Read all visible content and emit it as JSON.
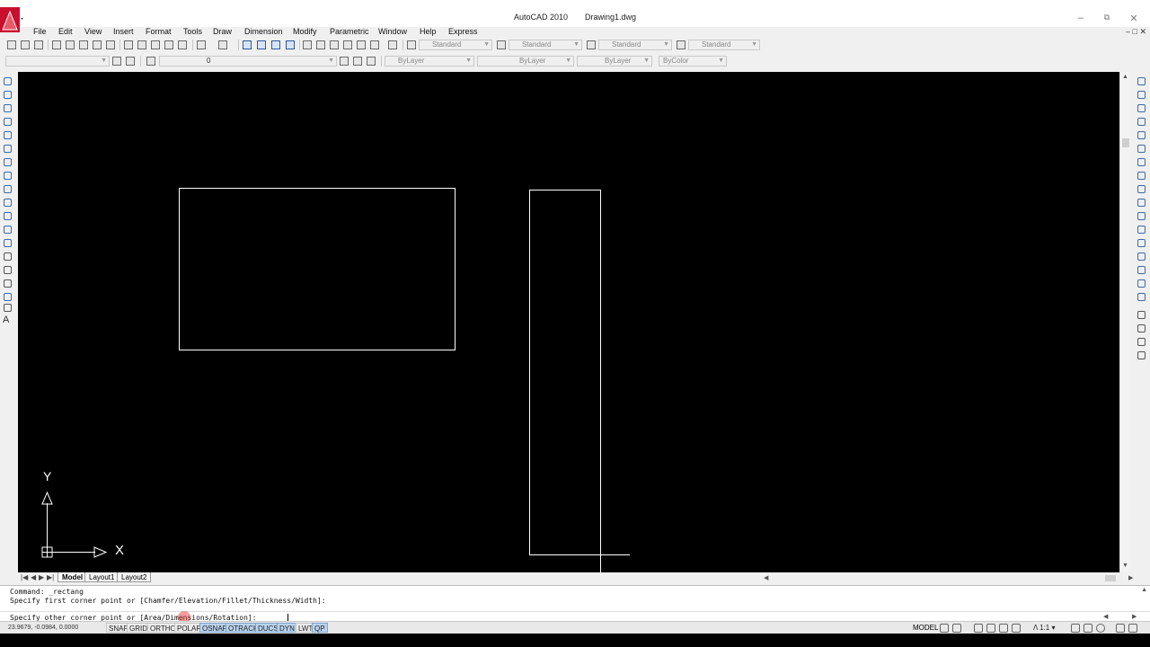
{
  "window": {
    "app_title": "AutoCAD 2010",
    "document_title": "Drawing1.dwg"
  },
  "menu": {
    "items": [
      "File",
      "Edit",
      "View",
      "Insert",
      "Format",
      "Tools",
      "Draw",
      "Dimension",
      "Modify",
      "Parametric",
      "Window",
      "Help",
      "Express"
    ]
  },
  "toolbar": {
    "text_style": "Standard",
    "dim_style": "Standard",
    "table_style": "Standard",
    "multileader_style": "Standard",
    "layer": "0",
    "color": "ByLayer",
    "linetype": "ByLayer",
    "lineweight": "ByLayer",
    "plot_style": "ByColor"
  },
  "canvas": {
    "background": "#000000",
    "line_color": "#ffffff",
    "ucs_x_label": "X",
    "ucs_y_label": "Y"
  },
  "tabs": {
    "items": [
      {
        "label": "Model",
        "active": true
      },
      {
        "label": "Layout1",
        "active": false
      },
      {
        "label": "Layout2",
        "active": false
      }
    ],
    "separator": "/"
  },
  "command": {
    "history": [
      "Command: _rectang",
      "Specify first corner point or [Chamfer/Elevation/Fillet/Thickness/Width]:"
    ],
    "prompt": "Specify other corner point or [Area/Dimensions/Rotation]: "
  },
  "status": {
    "coordinates": "23.9679, -0.0984, 0.0000",
    "toggles": [
      {
        "label": "SNAP",
        "on": false
      },
      {
        "label": "GRID",
        "on": false
      },
      {
        "label": "ORTHO",
        "on": false
      },
      {
        "label": "POLAR",
        "on": false
      },
      {
        "label": "OSNAP",
        "on": true
      },
      {
        "label": "OTRACK",
        "on": true
      },
      {
        "label": "DUCS",
        "on": true
      },
      {
        "label": "DYN",
        "on": true
      },
      {
        "label": "LWT",
        "on": false
      },
      {
        "label": "QP",
        "on": true
      }
    ],
    "space": "MODEL",
    "annotation_scale": "1:1"
  },
  "colors": {
    "toggle_on": "#b9d3ee",
    "accent": "#c8102e",
    "tool_icon": "#3c6aa8"
  }
}
